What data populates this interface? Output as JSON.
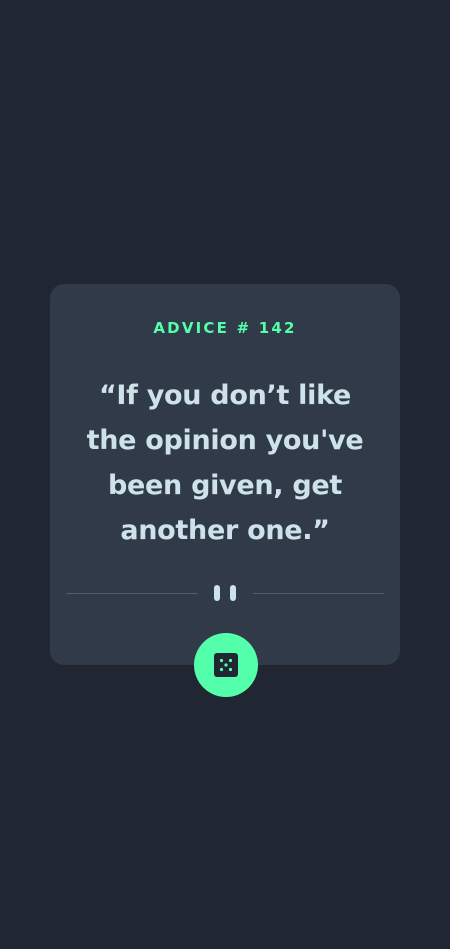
{
  "advice": {
    "id_label": "ADVICE # 142",
    "quote": "“If you don’t like the opinion you've been given, get another one.”"
  },
  "divider": {
    "icon": "pause-icon"
  },
  "button": {
    "icon": "dice-icon"
  },
  "colors": {
    "background": "#202733",
    "card": "#313a48",
    "accent": "#53ffaa",
    "text": "#cee3e9",
    "divider": "#4f5d74"
  }
}
